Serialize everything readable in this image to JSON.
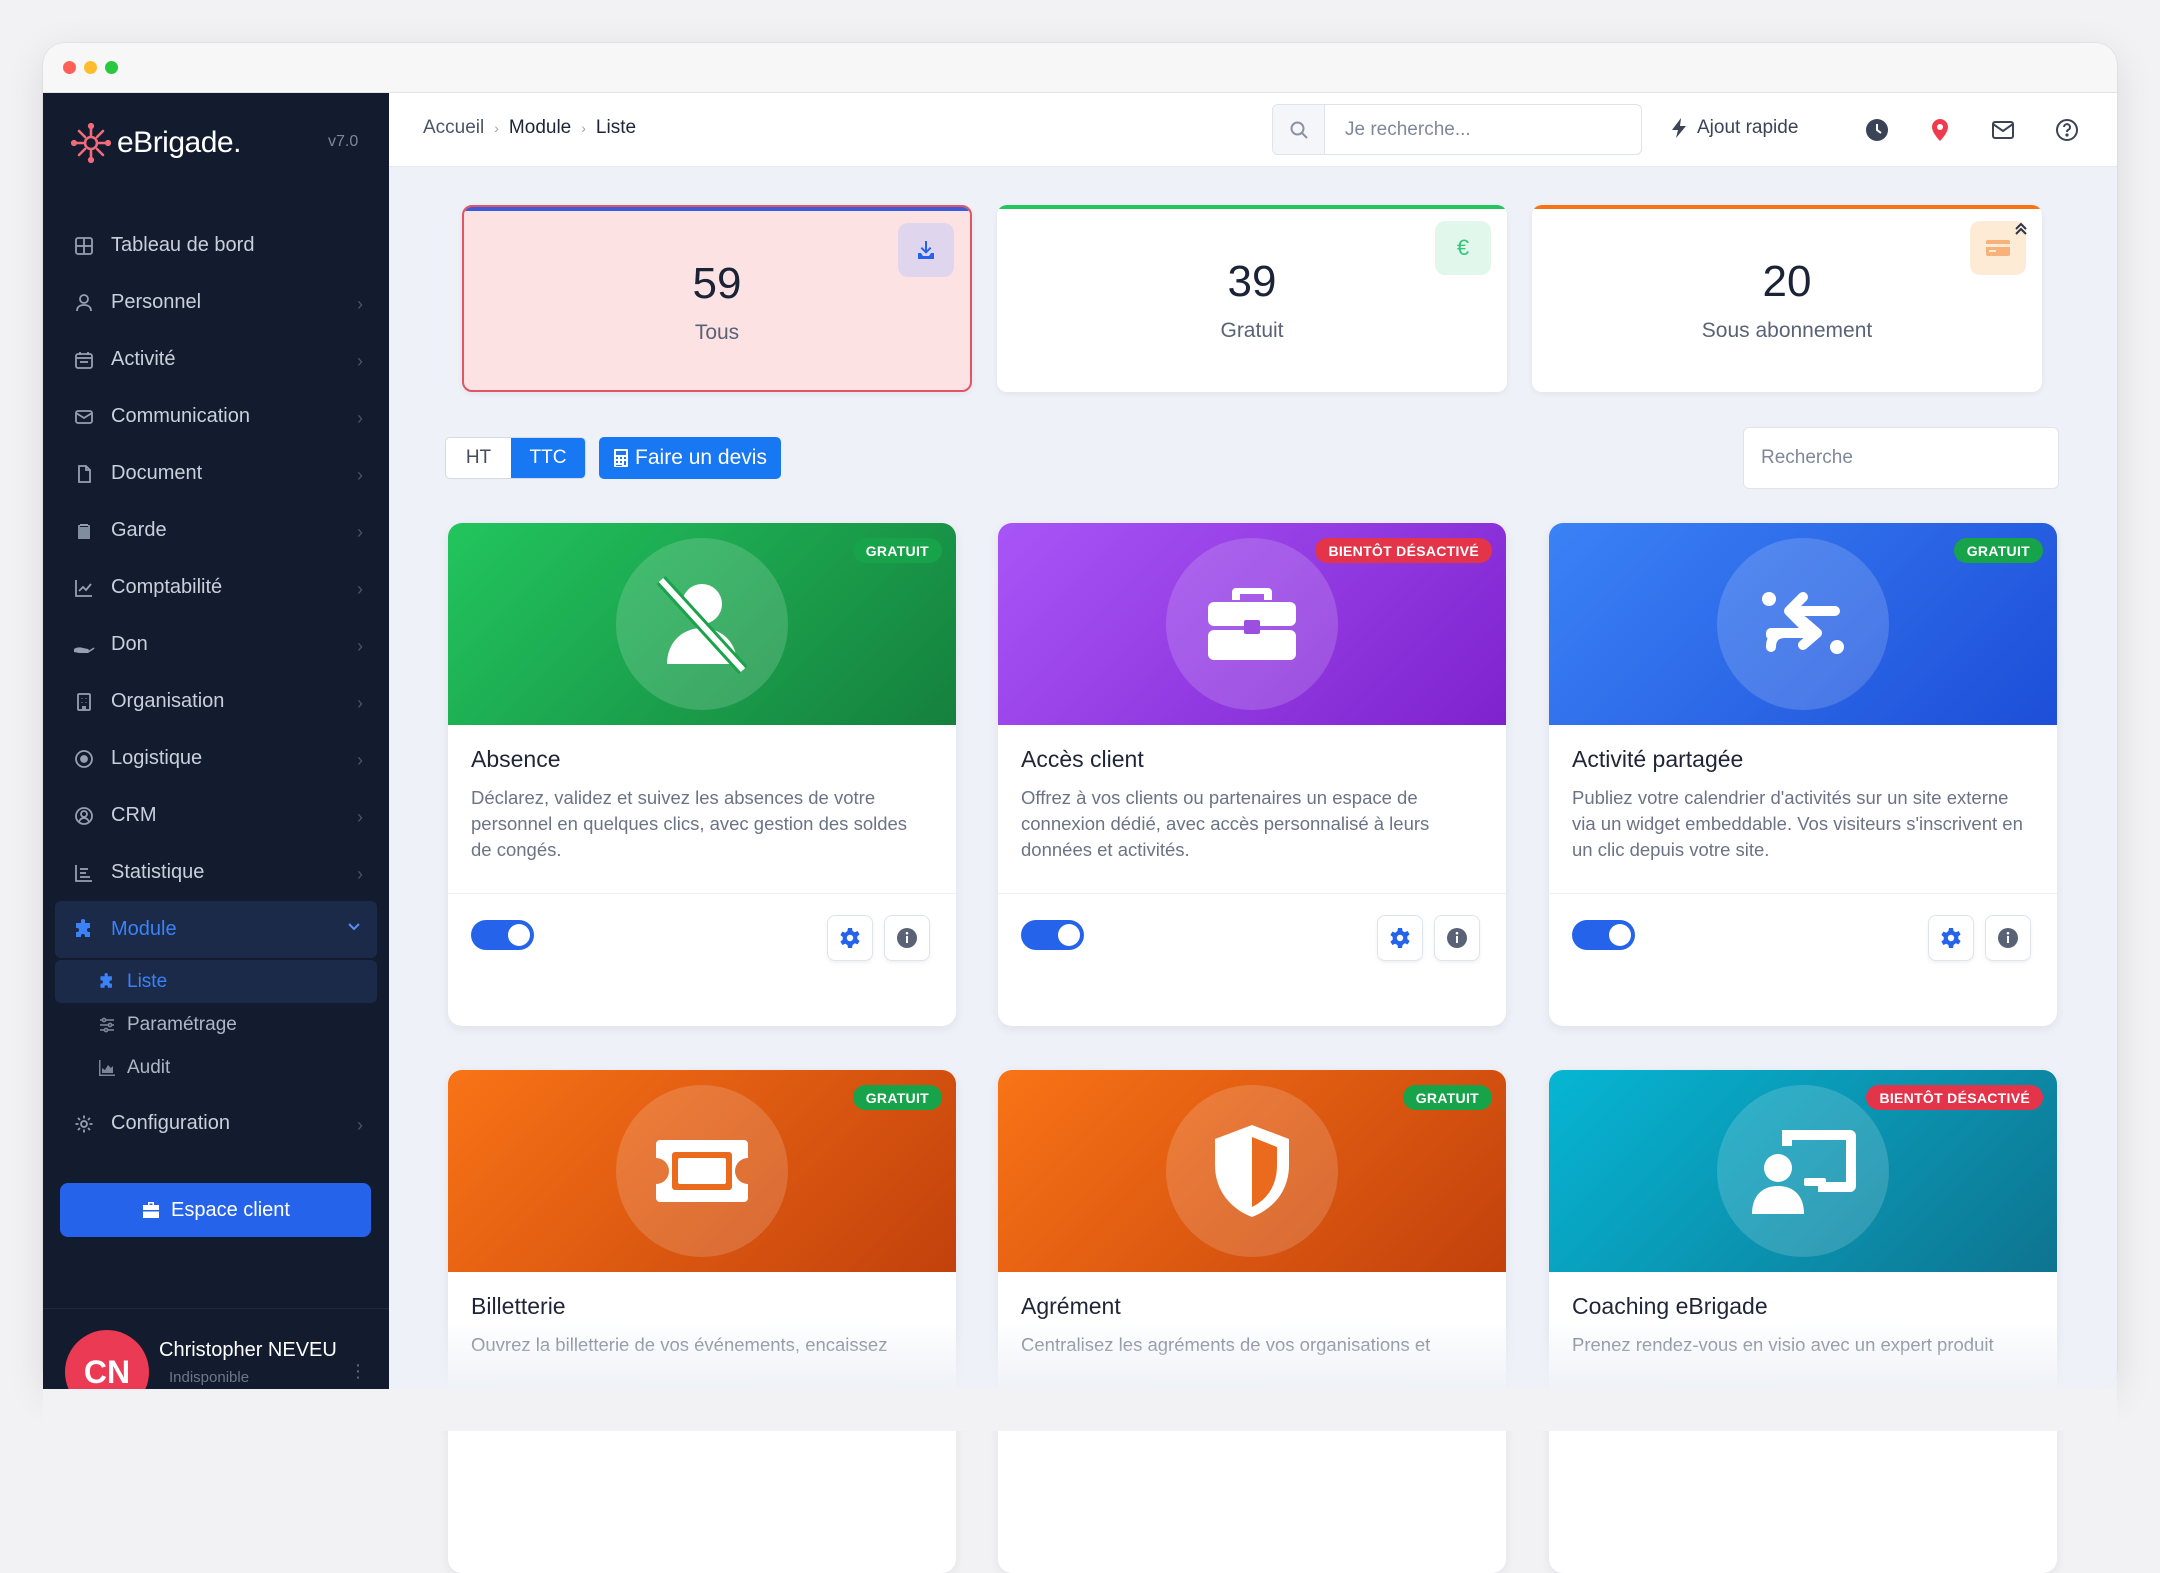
{
  "brand": {
    "name": "eBrigade.",
    "version": "v7.0"
  },
  "sidebar": {
    "items": [
      {
        "label": "Tableau de bord",
        "icon": "dashboard-icon"
      },
      {
        "label": "Personnel",
        "icon": "user-icon"
      },
      {
        "label": "Activité",
        "icon": "calendar-icon"
      },
      {
        "label": "Communication",
        "icon": "envelope-icon"
      },
      {
        "label": "Document",
        "icon": "document-icon"
      },
      {
        "label": "Garde",
        "icon": "clipboard-icon"
      },
      {
        "label": "Comptabilité",
        "icon": "chart-line-icon"
      },
      {
        "label": "Don",
        "icon": "hand-icon"
      },
      {
        "label": "Organisation",
        "icon": "building-icon"
      },
      {
        "label": "Logistique",
        "icon": "target-icon"
      },
      {
        "label": "CRM",
        "icon": "user-circle-icon"
      },
      {
        "label": "Statistique",
        "icon": "bars-icon"
      },
      {
        "label": "Module",
        "icon": "puzzle-icon"
      },
      {
        "label": "Configuration",
        "icon": "gear-icon"
      }
    ],
    "module_sub": [
      {
        "label": "Liste",
        "icon": "puzzle-icon"
      },
      {
        "label": "Paramétrage",
        "icon": "sliders-icon"
      },
      {
        "label": "Audit",
        "icon": "chart-area-icon"
      }
    ],
    "espace_client": "Espace client",
    "user": {
      "initials": "CN",
      "name": "Christopher NEVEU",
      "status": "Indisponible"
    }
  },
  "topbar": {
    "breadcrumb": [
      "Accueil",
      "Module",
      "Liste"
    ],
    "search_placeholder": "Je recherche...",
    "quick_add": "Ajout rapide"
  },
  "stats": [
    {
      "value": "59",
      "label": "Tous",
      "accent": "#3b5bdb",
      "icon": "download-icon"
    },
    {
      "value": "39",
      "label": "Gratuit",
      "accent": "#22c55e",
      "icon": "euro-icon"
    },
    {
      "value": "20",
      "label": "Sous abonnement",
      "accent": "#f97316",
      "icon": "credit-card-icon"
    }
  ],
  "toolbar": {
    "ht": "HT",
    "ttc": "TTC",
    "devis": "Faire un devis",
    "filter_placeholder": "Recherche"
  },
  "modules": [
    {
      "title": "Absence",
      "tag": "GRATUIT",
      "tag_type": "free",
      "icon": "user-slash-icon",
      "desc": "Déclarez, validez et suivez les absences de votre personnel en quelques clics, avec gestion des soldes de congés.",
      "colors": [
        "#22c55e",
        "#15803d"
      ]
    },
    {
      "title": "Accès client",
      "tag": "BIENTÔT DÉSACTIVÉ",
      "tag_type": "off",
      "icon": "briefcase-icon",
      "desc": "Offrez à vos clients ou partenaires un espace de connexion dédié, avec accès personnalisé à leurs données et activités.",
      "colors": [
        "#a855f7",
        "#7e22ce"
      ]
    },
    {
      "title": "Activité partagée",
      "tag": "GRATUIT",
      "tag_type": "free",
      "icon": "share-arrows-icon",
      "desc": "Publiez votre calendrier d'activités sur un site externe via un widget embeddable. Vos visiteurs s'inscrivent en un clic depuis votre site.",
      "colors": [
        "#3b82f6",
        "#1d4ed8"
      ]
    },
    {
      "title": "Billetterie",
      "tag": "GRATUIT",
      "tag_type": "free",
      "icon": "ticket-icon",
      "desc": "Ouvrez la billetterie de vos événements, encaissez",
      "colors": [
        "#f97316",
        "#c2410c"
      ]
    },
    {
      "title": "Agrément",
      "tag": "GRATUIT",
      "tag_type": "free",
      "icon": "shield-icon",
      "desc": "Centralisez les agréments de vos organisations et",
      "colors": [
        "#f97316",
        "#c2410c"
      ]
    },
    {
      "title": "Coaching eBrigade",
      "tag": "BIENTÔT DÉSACTIVÉ",
      "tag_type": "off",
      "icon": "presentation-icon",
      "desc": "Prenez rendez-vous en visio avec un expert produit",
      "colors": [
        "#06b6d4",
        "#0e7490"
      ]
    }
  ]
}
